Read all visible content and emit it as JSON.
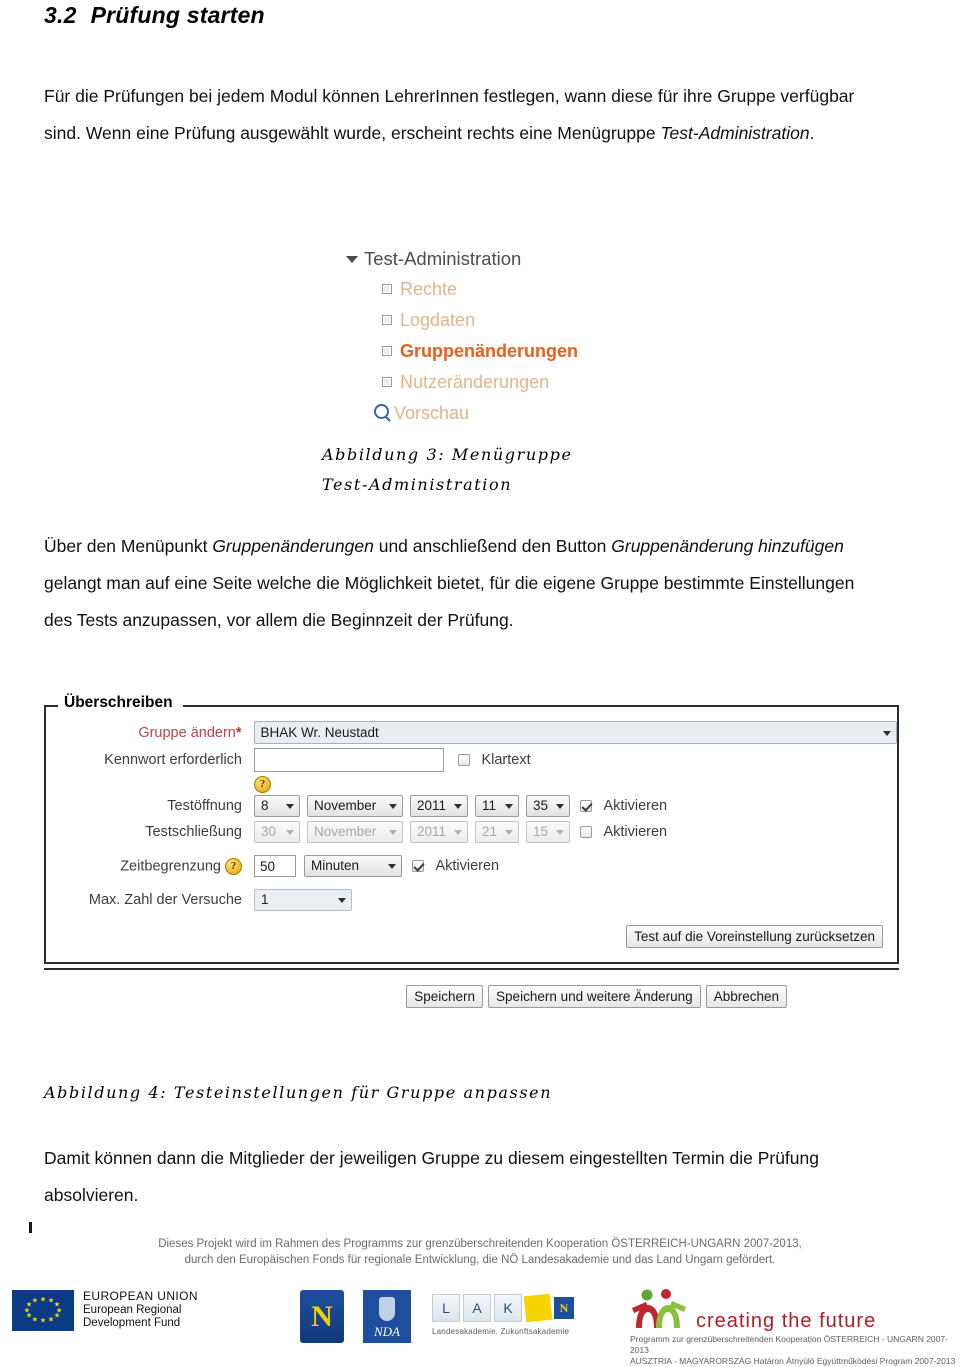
{
  "section": {
    "number": "3.2",
    "title": "Prüfung starten"
  },
  "paragraphs": {
    "intro_1": "Für die Prüfungen bei jedem Modul können LehrerInnen festlegen, wann diese für ihre Gruppe verfügbar sind. Wenn eine Prüfung ausgewählt wurde, erscheint rechts eine Menügruppe ",
    "intro_1_italic": "Test-Administration",
    "intro_1_end": ".",
    "mid_a": "Über den Menüpunkt ",
    "mid_a_italic": "Gruppenänderungen",
    "mid_b": " und anschließend den Button ",
    "mid_b_italic": "Gruppenänderung hinzufügen",
    "mid_c": " gelangt man auf eine Seite welche die Möglichkeit bietet, für die eigene Gruppe bestimmte Einstellungen des Tests anzupassen, vor allem die Beginnzeit der Prüfung.",
    "outro": "Damit können dann die Mitglieder der jeweiligen Gruppe zu diesem eingestellten Termin die Prüfung absolvieren."
  },
  "figure3": {
    "caption_line1": "Abbildung 3: Menügruppe",
    "caption_line2": "Test-Administration",
    "menu": {
      "root_label": "Test-Administration",
      "items": [
        {
          "label": "Rechte",
          "icon": "square-bullet-icon",
          "active": false
        },
        {
          "label": "Logdaten",
          "icon": "square-bullet-icon",
          "active": false
        },
        {
          "label": "Gruppenänderungen",
          "icon": "square-bullet-icon",
          "active": true
        },
        {
          "label": "Nutzeränderungen",
          "icon": "square-bullet-icon",
          "active": false
        }
      ],
      "preview_label": "Vorschau",
      "colors": {
        "root": "#4c4c4c",
        "item": "#e2b48c",
        "active_item": "#e8601c"
      }
    }
  },
  "figure4": {
    "caption": "Abbildung 4: Testeinstellungen für Gruppe anpassen",
    "legend": "Überschreiben",
    "fields": {
      "group": {
        "label": "Gruppe ändern",
        "required_marker": "*",
        "value": "BHAK Wr. Neustadt"
      },
      "password": {
        "label": "Kennwort erforderlich",
        "value": "",
        "cleartext_label": "Klartext",
        "cleartext_checked": false,
        "help_glyph": "?"
      },
      "test_open": {
        "label": "Testöffnung",
        "day": "8",
        "month": "November",
        "year": "2011",
        "hour": "11",
        "minute": "35",
        "activate_label": "Aktivieren",
        "activated": true,
        "disabled": false
      },
      "test_close": {
        "label": "Testschließung",
        "day": "30",
        "month": "November",
        "year": "2011",
        "hour": "21",
        "minute": "15",
        "activate_label": "Aktivieren",
        "activated": false,
        "disabled": true
      },
      "time_limit": {
        "label": "Zeitbegrenzung",
        "help_glyph": "?",
        "value": "50",
        "unit": "Minuten",
        "activate_label": "Aktivieren",
        "activated": true
      },
      "max_attempts": {
        "label": "Max. Zahl der Versuche",
        "value": "1"
      }
    },
    "buttons": {
      "reset": "Test auf die Voreinstellung zurücksetzen",
      "save": "Speichern",
      "save_and_more": "Speichern und weitere Änderung",
      "cancel": "Abbrechen"
    }
  },
  "footer": {
    "line1": "Dieses Projekt wird im Rahmen des Programms zur grenzüberschreitenden Kooperation ÖSTERREICH-UNGARN 2007-2013,",
    "line2": "durch den Europäischen Fonds für regionale Entwicklung, die NÖ Landesakademie und das Land Ungarn gefördert.",
    "logos": {
      "eu": {
        "line1": "EUROPEAN UNION",
        "line2": "European Regional",
        "line3": "Development Fund",
        "flag_color": "#0b3b85",
        "star_color": "#ffd617"
      },
      "noe": {
        "letter": "N"
      },
      "nda": {
        "text": "NDA"
      },
      "lak": {
        "letters": [
          "L",
          "A",
          "K"
        ],
        "badge_letter": "N",
        "subtitle": "Landesakademie. Zukunftsakademie"
      },
      "creating_future": {
        "word": "creating the future",
        "sub1": "Programm zur grenzüberschreitenden Kooperation ÖSTERREICH - UNGARN 2007-2013",
        "sub2": "AUSZTRIA - MAGYARORSZÁG Határon Átnyúló Együttműködési Program 2007-2013",
        "color": "#b01e28"
      }
    }
  }
}
